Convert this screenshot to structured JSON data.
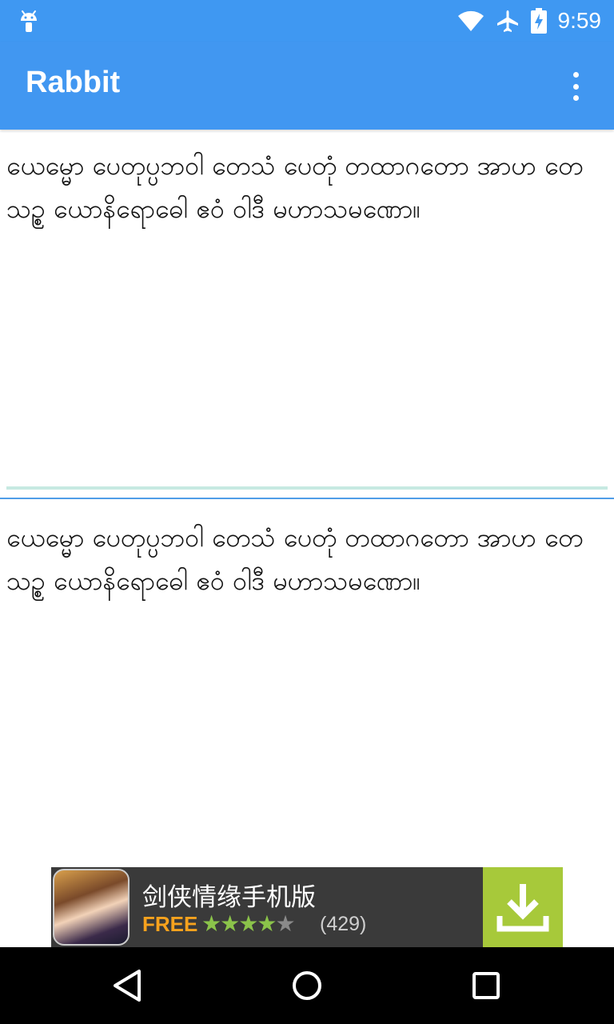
{
  "status_bar": {
    "time": "9:59",
    "icons": [
      "android-icon",
      "wifi-icon",
      "airplane-icon",
      "battery-charging-icon"
    ]
  },
  "app_bar": {
    "title": "Rabbit",
    "menu_icon": "overflow-menu-icon"
  },
  "content": {
    "text_top": "ယေမ္မော ပေတုပ္ပဘဝါ တေသံ ပေတုံ တထာဂတော အာဟ တေသဥ္စ ယောနိရောဓေါ ဧဝံ ဝါဒီ မဟာသမဏော။",
    "text_bottom": "ယေမ္မော ပေတုပ္ပဘဝါ တေသံ ပေတုံ တထာဂတော အာဟ တေသဥ္စ ယောနိရောဓေါ ဧဝံ ဝါဒီ မဟာသမဏော။"
  },
  "ad": {
    "title": "剑侠情缘手机版",
    "free_label": "FREE",
    "rating": 4,
    "rating_max": 5,
    "reviews": "(429)",
    "download_icon": "download-icon"
  },
  "nav_bar": {
    "buttons": [
      "back-icon",
      "home-icon",
      "recents-icon"
    ]
  },
  "colors": {
    "primary": "#4197f1",
    "status_bar": "#3f98f2",
    "ad_download": "#a7c93a",
    "ad_free": "#f7a21d"
  }
}
